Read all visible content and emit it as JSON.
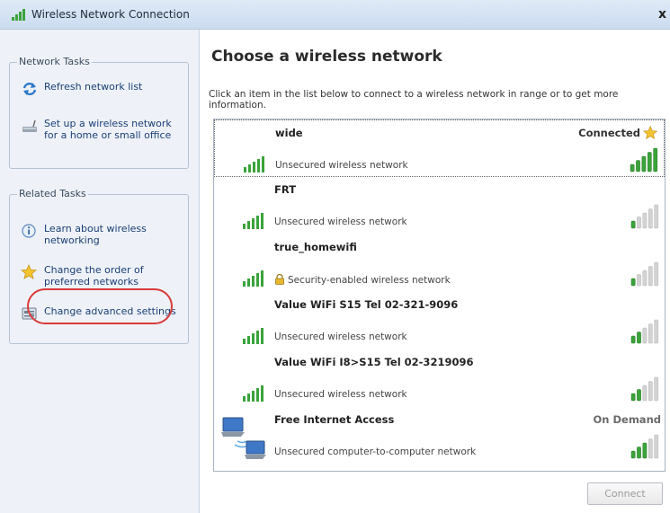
{
  "window": {
    "title": "Wireless Network Connection",
    "close_glyph": "x"
  },
  "left": {
    "network_tasks": {
      "title": "Network Tasks",
      "items": [
        {
          "label": "Refresh network list",
          "icon": "refresh-icon"
        },
        {
          "label": "Set up a wireless network for a home or small office",
          "icon": "wireless-router-icon"
        }
      ]
    },
    "related_tasks": {
      "title": "Related Tasks",
      "items": [
        {
          "label": "Learn about wireless networking",
          "icon": "info-icon"
        },
        {
          "label": "Change the order of preferred networks",
          "icon": "star-icon"
        },
        {
          "label": "Change advanced settings",
          "icon": "settings-icon"
        }
      ]
    }
  },
  "main": {
    "heading": "Choose a wireless network",
    "intro": "Click an item in the list below to connect to a wireless network in range or to get more information.",
    "networks": [
      {
        "name": "wide",
        "description": "Unsecured wireless network",
        "status": "Connected",
        "signal": 5,
        "secured": false
      },
      {
        "name": "FRT",
        "description": "Unsecured wireless network",
        "status": "",
        "signal": 1,
        "secured": false
      },
      {
        "name": "true_homewifi",
        "description": "Security-enabled wireless network",
        "status": "",
        "signal": 1,
        "secured": true
      },
      {
        "name": "Value WiFi S15 Tel 02-321-9096",
        "description": "Unsecured wireless network",
        "status": "",
        "signal": 2,
        "secured": false
      },
      {
        "name": "Value WiFi I8>S15 Tel 02-3219096",
        "description": "Unsecured wireless network",
        "status": "",
        "signal": 2,
        "secured": false
      },
      {
        "name": "Free Internet Access",
        "description": "Unsecured computer-to-computer network",
        "status": "On Demand",
        "signal": 3,
        "secured": false
      }
    ],
    "connect_label": "Connect"
  },
  "colors": {
    "signal_on": "#3aa33a",
    "signal_off": "#d3d3d3",
    "highlight": "#d93a3a",
    "link": "#1c3f75"
  }
}
